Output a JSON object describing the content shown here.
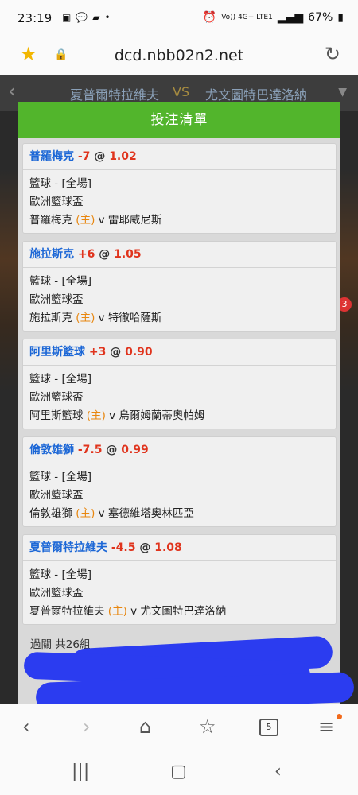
{
  "statusbar": {
    "time": "23:19",
    "network": "Vo)) 4G+ LTE1",
    "battery": "67%"
  },
  "browser": {
    "url": "dcd.nbb02n2.net"
  },
  "background_header": {
    "team1": "夏普爾特拉維夫",
    "vs": "VS",
    "team2": "尤文圖特巴達洛納",
    "badge": "3"
  },
  "modal": {
    "title": "投注清單",
    "bets": [
      {
        "team": "普羅梅克",
        "handicap": "-7",
        "at": "@",
        "odds": "1.02",
        "sport": "籃球 - [全場]",
        "league": "歐洲籃球盃",
        "home_team": "普羅梅克",
        "home_tag": "(主)",
        "versus": "v 雷耶威尼斯"
      },
      {
        "team": "施拉斯克",
        "handicap": "+6",
        "at": "@",
        "odds": "1.05",
        "sport": "籃球 - [全場]",
        "league": "歐洲籃球盃",
        "home_team": "施拉斯克",
        "home_tag": "(主)",
        "versus": "v 特徹哈薩斯"
      },
      {
        "team": "阿里斯籃球",
        "handicap": "+3",
        "at": "@",
        "odds": "0.90",
        "sport": "籃球 - [全場]",
        "league": "歐洲籃球盃",
        "home_team": "阿里斯籃球",
        "home_tag": "(主)",
        "versus": "v 烏爾姆蘭蒂奧帕姆"
      },
      {
        "team": "倫敦雄獅",
        "handicap": "-7.5",
        "at": "@",
        "odds": "0.99",
        "sport": "籃球 - [全場]",
        "league": "歐洲籃球盃",
        "home_team": "倫敦雄獅",
        "home_tag": "(主)",
        "versus": "v 塞德維塔奧林匹亞"
      },
      {
        "team": "夏普爾特拉維夫",
        "handicap": "-4.5",
        "at": "@",
        "odds": "1.08",
        "sport": "籃球 - [全場]",
        "league": "歐洲籃球盃",
        "home_team": "夏普爾特拉維夫",
        "home_tag": "(主)",
        "versus": "v 尤文圖特巴達洛納"
      }
    ],
    "parlay_text": "過關 共26組"
  },
  "browser_nav": {
    "tab_count": "5"
  },
  "colors": {
    "header_green": "#52b52c",
    "team_blue": "#1c67d6",
    "odds_red": "#e0341d",
    "home_orange": "#e8860e",
    "scribble": "#2b3cf0"
  }
}
